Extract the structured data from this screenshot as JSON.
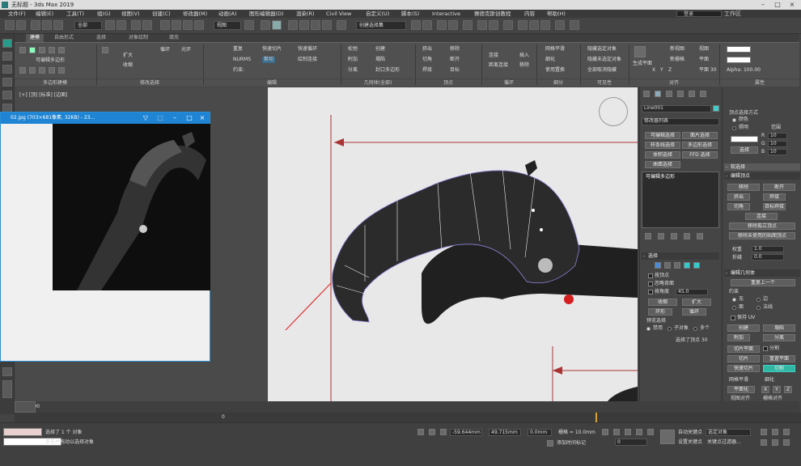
{
  "window": {
    "title": "无标题 - 3ds Max 2019",
    "controls": [
      "–",
      "□",
      "×"
    ]
  },
  "menu": {
    "items": [
      "文件(F)",
      "编辑(E)",
      "工具(T)",
      "组(G)",
      "视图(V)",
      "创建(C)",
      "修改器(M)",
      "动画(A)",
      "图形编辑器(D)",
      "渲染(R)",
      "Civil View",
      "自定义(U)",
      "脚本(S)",
      "Interactive",
      "赛德克斯创教程",
      "内容",
      "帮助(H)"
    ],
    "login": "登录",
    "workspace": "工作区"
  },
  "toolbar": {
    "selection_filter": "全部",
    "coord_system": "视图",
    "named_selection": "创建选择集"
  },
  "ribbon": {
    "tabs": [
      "建模",
      "自由形式",
      "选择",
      "对象绘制",
      "填充"
    ],
    "active_tab": "建模",
    "editable_poly_label": "可编辑多边形",
    "modify_selection": [
      "扩大",
      "收缩",
      "循环",
      "光环"
    ],
    "edit_items": [
      "重复",
      "NURMS",
      "快速切片",
      "剪切",
      "快速循环",
      "绘制连接",
      "约束:"
    ],
    "geometry_items": [
      "松弛",
      "附加",
      "分离",
      "创建",
      "塌陷",
      "封口多边形"
    ],
    "vertex_items": [
      "挤出",
      "切角",
      "焊接",
      "移除",
      "断开",
      "目标"
    ],
    "loop_items": [
      "连接",
      "距离连接",
      "插入",
      "移除"
    ],
    "subdivision_items": [
      "网格平滑",
      "细化",
      "使用置换"
    ],
    "visibility_items": [
      "隐藏选定对象",
      "隐藏未选定对象",
      "全部取消隐藏"
    ],
    "align_items": [
      "生成平面",
      "X",
      "Y",
      "Z",
      "新视图",
      "新栅格",
      "视图",
      "平面",
      "平面 30"
    ],
    "props_items": [
      "Alpha: 100.00"
    ],
    "groups": [
      "多边形建模",
      "修改选择",
      "编辑",
      "几何体(全部)",
      "顶点",
      "循环",
      "细分",
      "可见性",
      "对齐",
      "属性"
    ]
  },
  "viewport": {
    "label": "[+] [顶] [标准] [边面]"
  },
  "photo_window": {
    "title": "02.jpg (703×681像素, 32KB) - 23..."
  },
  "command_panel": {
    "object_name": "Line001",
    "modifier_list": "修改器列表",
    "buttons": [
      "可编辑选择",
      "面片选择",
      "样条线选择",
      "多边形选择",
      "体积选择",
      "FFD 选择",
      "曲面选择"
    ],
    "stack_item": "可编辑多边形",
    "selection_rollout": "选择",
    "by_vertex": "按顶点",
    "ignore_backfacing": "忽略背面",
    "by_angle": "按角度",
    "angle_value": "45.0",
    "shrink": "收缩",
    "grow": "扩大",
    "ring": "环形",
    "loop": "循环",
    "preview_selection": "预览选择",
    "preview_options": [
      "禁用",
      "子对象",
      "多个"
    ],
    "selected_status": "选择了顶点 30"
  },
  "props_panel": {
    "vertex_select_mode": "顶点选择方式",
    "color_opt": "颜色",
    "illum_opt": "照明",
    "range": "范围",
    "rgb": [
      {
        "k": "R",
        "v": "10"
      },
      {
        "k": "G",
        "v": "10"
      },
      {
        "k": "B",
        "v": "10"
      }
    ],
    "select_btn": "选择",
    "soft_selection": "软选择",
    "edit_vertices": "编辑顶点",
    "ev_buttons": [
      "移除",
      "断开",
      "挤出",
      "焊接",
      "切角",
      "目标焊接",
      "连接",
      "移除孤立顶点",
      "移除未使用的贴图顶点"
    ],
    "weight": "权重",
    "crease": "折缝",
    "weight_val": "1.0",
    "crease_val": "0.0",
    "edit_geometry": "编辑几何体",
    "repeat_last": "重复上一个",
    "constraints": "约束",
    "constraint_opts": [
      "无",
      "边",
      "面",
      "法线"
    ],
    "preserve_uv": "保持 UV",
    "geo_buttons": [
      "创建",
      "塌陷",
      "附加",
      "分离",
      "切片平面",
      "分割",
      "切片",
      "重置平面",
      "快速切片",
      "切割"
    ],
    "bottom_buttons": [
      "网格平滑",
      "细化",
      "平面化",
      "X",
      "Y",
      "Z",
      "视图对齐",
      "栅格对齐"
    ]
  },
  "timeline": {
    "frame": "0 / 100",
    "range_start": "0",
    "range_end": "100"
  },
  "status": {
    "selection": "选择了 1 个 对象",
    "hint": "单击并拖动以选择对象",
    "x": "-59.644mm",
    "y": "49.715mm",
    "z": "0.0mm",
    "grid": "栅格 = 10.0mm",
    "add_time_tag": "添加时间标记",
    "auto_key": "自动关键点",
    "selected_obj": "选定对象",
    "set_key": "设置关键点",
    "key_filters": "关键点过滤器...",
    "frame_field": "0"
  }
}
